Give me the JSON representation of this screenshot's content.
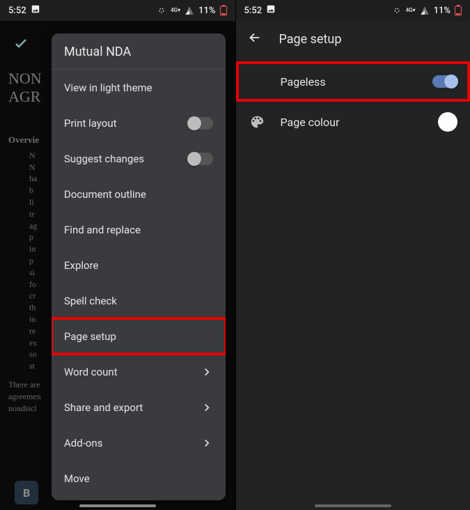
{
  "status": {
    "time": "5:52",
    "battery_pct": "11%"
  },
  "left": {
    "doc_title_l1": "NON",
    "doc_title_l2": "AGR",
    "doc_h": "Overvie",
    "doc_p": "N\nN\nha\nb\nli\ntr\nag\np\nin\np\nsi\nfo\ncr\nth\nin\nre\nex\nso\nst",
    "doc_p2": "There are\nagreemen\nnondiscl",
    "menu_title": "Mutual NDA",
    "items": [
      {
        "label": "View in light theme",
        "type": "plain"
      },
      {
        "label": "Print layout",
        "type": "switch",
        "on": false
      },
      {
        "label": "Suggest changes",
        "type": "switch",
        "on": false
      },
      {
        "label": "Document outline",
        "type": "plain"
      },
      {
        "label": "Find and replace",
        "type": "plain"
      },
      {
        "label": "Explore",
        "type": "plain"
      },
      {
        "label": "Spell check",
        "type": "plain"
      },
      {
        "label": "Page setup",
        "type": "plain",
        "highlight": true
      },
      {
        "label": "Word count",
        "type": "nav"
      },
      {
        "label": "Share and export",
        "type": "nav"
      },
      {
        "label": "Add-ons",
        "type": "nav"
      },
      {
        "label": "Move",
        "type": "plain"
      }
    ],
    "toolbar": {
      "bold": "B"
    }
  },
  "right": {
    "header": "Page setup",
    "rows": [
      {
        "label": "Pageless",
        "type": "switch",
        "on": true,
        "highlight": true
      },
      {
        "label": "Page colour",
        "type": "color",
        "icon": "palette"
      }
    ]
  }
}
